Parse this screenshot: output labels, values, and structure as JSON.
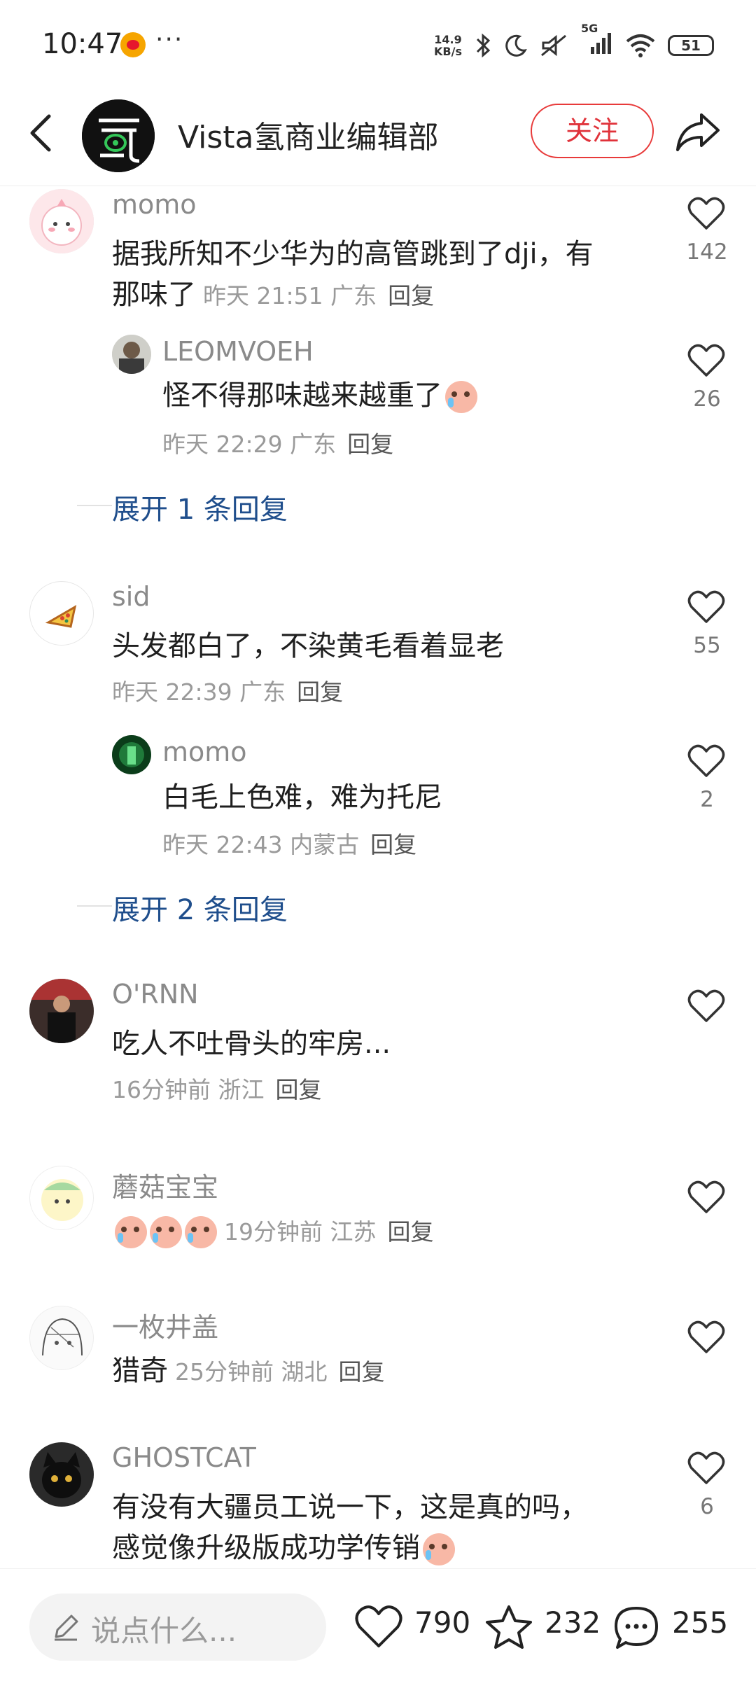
{
  "status": {
    "time": "10:47",
    "net_speed_value": "14.9",
    "net_speed_unit": "KB/s",
    "signal": "5G",
    "battery": "51"
  },
  "header": {
    "title": "Vista氢商业编辑部",
    "follow_label": "关注"
  },
  "comments": [
    {
      "name": "momo",
      "text_line1": "据我所知不少华为的高管跳到了dji，有",
      "text_line2": "那味了",
      "time": "昨天 21:51",
      "location": "广东",
      "reply": "回复",
      "likes": "142"
    },
    {
      "name": "LEOMVOEH",
      "text": "怪不得那味越来越重了",
      "time": "昨天 22:29",
      "location": "广东",
      "reply": "回复",
      "likes": "26"
    },
    {
      "expand": "展开 1 条回复"
    },
    {
      "name": "sid",
      "text": "头发都白了，不染黄毛看着显老",
      "time": "昨天 22:39",
      "location": "广东",
      "reply": "回复",
      "likes": "55"
    },
    {
      "name": "momo",
      "text": "白毛上色难，难为托尼",
      "time": "昨天 22:43",
      "location": "内蒙古",
      "reply": "回复",
      "likes": "2"
    },
    {
      "expand": "展开 2 条回复"
    },
    {
      "name": "O'RNN",
      "text": "吃人不吐骨头的牢房...",
      "time": "16分钟前",
      "location": "浙江",
      "reply": "回复"
    },
    {
      "name": "蘑菇宝宝",
      "time": "19分钟前",
      "location": "江苏",
      "reply": "回复"
    },
    {
      "name": "一枚井盖",
      "text": "猎奇",
      "time": "25分钟前",
      "location": "湖北",
      "reply": "回复"
    },
    {
      "name": "GHOSTCAT",
      "text_line1": "有没有大疆员工说一下，这是真的吗，",
      "text_line2": "感觉像升级版成功学传销",
      "likes": "6"
    }
  ],
  "bottom": {
    "input_placeholder": "说点什么...",
    "likes": "790",
    "favorites": "232",
    "comments": "255"
  },
  "colors": {
    "accent_red": "#e0323a",
    "link_blue": "#1f4e8c"
  }
}
